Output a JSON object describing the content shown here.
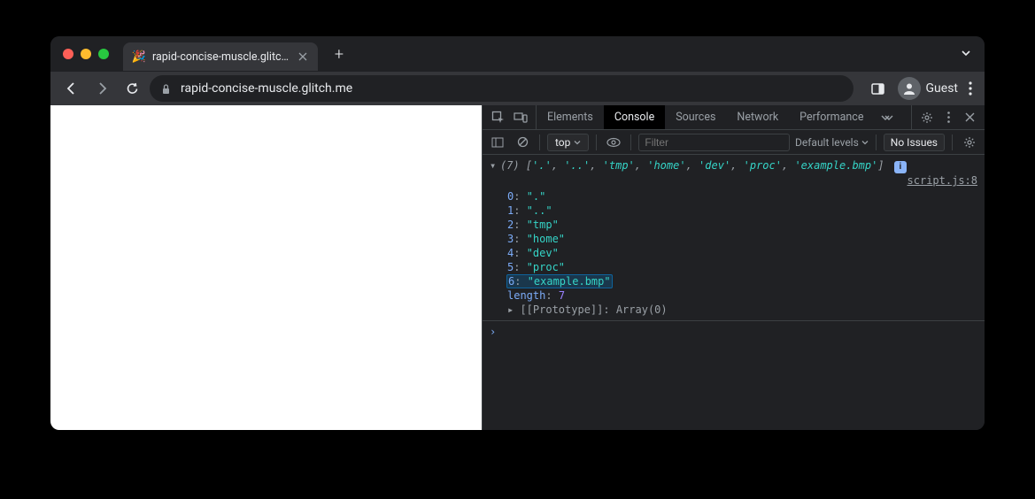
{
  "tab": {
    "favicon": "🎉",
    "title": "rapid-concise-muscle.glitch.me"
  },
  "address": {
    "url": "rapid-concise-muscle.glitch.me",
    "profile_label": "Guest"
  },
  "devtools": {
    "tabs": {
      "elements": "Elements",
      "console": "Console",
      "sources": "Sources",
      "network": "Network",
      "performance": "Performance"
    },
    "console_toolbar": {
      "context": "top",
      "filter_placeholder": "Filter",
      "levels": "Default levels",
      "issues": "No Issues"
    },
    "log": {
      "count": "(7)",
      "preview_items": [
        "'.'",
        "'..'",
        "'tmp'",
        "'home'",
        "'dev'",
        "'proc'",
        "'example.bmp'"
      ],
      "source": "script.js:8",
      "entries": [
        {
          "idx": "0",
          "val": "\".\""
        },
        {
          "idx": "1",
          "val": "\"..\""
        },
        {
          "idx": "2",
          "val": "\"tmp\""
        },
        {
          "idx": "3",
          "val": "\"home\""
        },
        {
          "idx": "4",
          "val": "\"dev\""
        },
        {
          "idx": "5",
          "val": "\"proc\""
        },
        {
          "idx": "6",
          "val": "\"example.bmp\"",
          "highlighted": true
        }
      ],
      "length_label": "length",
      "length_val": "7",
      "proto_label": "[[Prototype]]",
      "proto_val": "Array(0)"
    }
  }
}
